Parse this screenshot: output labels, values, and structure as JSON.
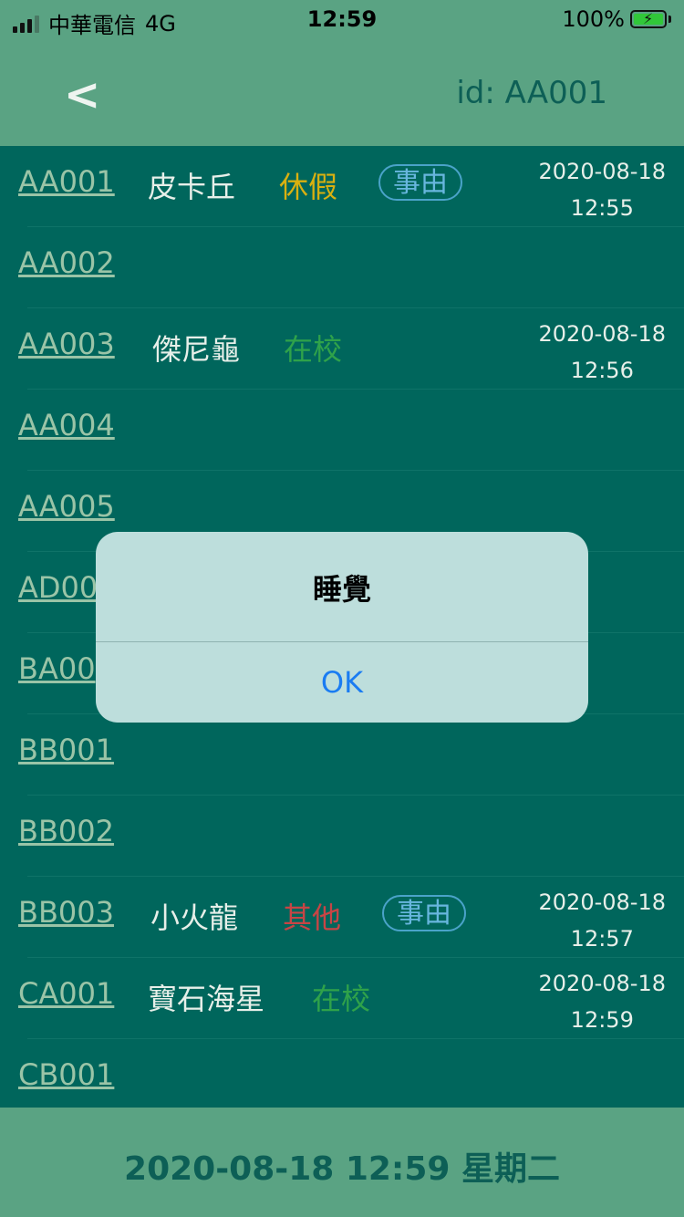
{
  "status_bar": {
    "carrier": "中華電信",
    "network": "4G",
    "time": "12:59",
    "battery": "100%"
  },
  "header": {
    "back_label": "<",
    "id_label": "id: AA001"
  },
  "colors": {
    "leave": "#d9b010",
    "present": "#2fa24a",
    "other": "#c74545",
    "reason_border": "#4aa3c9"
  },
  "rows": [
    {
      "code": "AA001",
      "name": "皮卡丘",
      "status": "休假",
      "status_type": "leave",
      "reason": "事由",
      "date": "2020-08-18",
      "time": "12:55"
    },
    {
      "code": "AA002"
    },
    {
      "code": "AA003",
      "name": "傑尼龜",
      "status": "在校",
      "status_type": "present",
      "date": "2020-08-18",
      "time": "12:56"
    },
    {
      "code": "AA004"
    },
    {
      "code": "AA005"
    },
    {
      "code": "AD00"
    },
    {
      "code": "BA00"
    },
    {
      "code": "BB001"
    },
    {
      "code": "BB002"
    },
    {
      "code": "BB003",
      "name": "小火龍",
      "status": "其他",
      "status_type": "other",
      "reason": "事由",
      "date": "2020-08-18",
      "time": "12:57"
    },
    {
      "code": "CA001",
      "name": "寶石海星",
      "status": "在校",
      "status_type": "present",
      "date": "2020-08-18",
      "time": "12:59"
    },
    {
      "code": "CB001"
    }
  ],
  "alert": {
    "title": "睡覺",
    "button": "OK"
  },
  "footer": {
    "datetime": "2020-08-18  12:59    星期二"
  }
}
